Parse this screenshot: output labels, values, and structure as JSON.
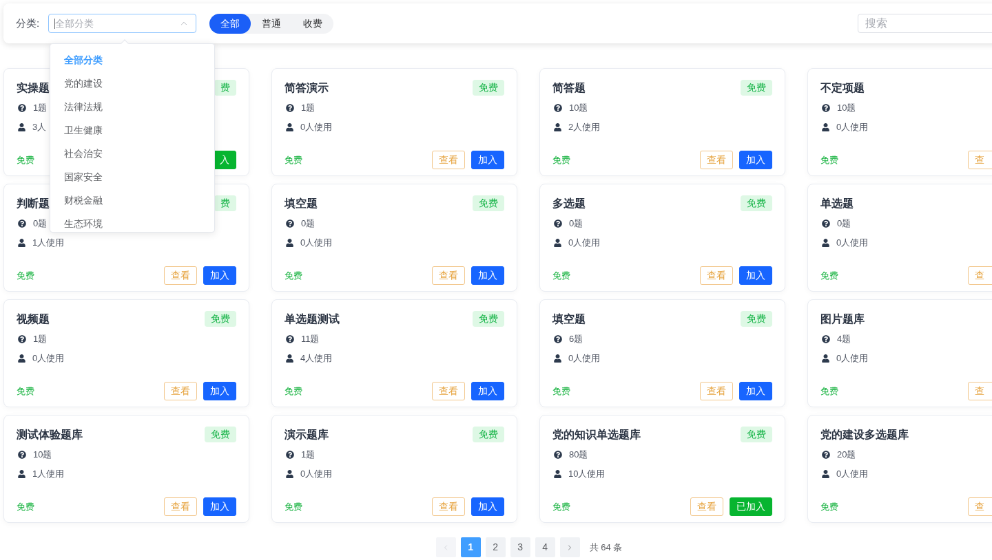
{
  "filter_bar": {
    "category_label": "分类:",
    "category_select": {
      "placeholder": "全部分类",
      "focused": true,
      "expanded": true,
      "options": [
        {
          "label": "全部分类",
          "selected": true
        },
        {
          "label": "党的建设",
          "selected": false
        },
        {
          "label": "法律法规",
          "selected": false
        },
        {
          "label": "卫生健康",
          "selected": false
        },
        {
          "label": "社会治安",
          "selected": false
        },
        {
          "label": "国家安全",
          "selected": false
        },
        {
          "label": "财税金融",
          "selected": false
        },
        {
          "label": "生态环境",
          "selected": false
        }
      ]
    },
    "type_tabs": [
      {
        "label": "全部",
        "selected": true
      },
      {
        "label": "普通",
        "selected": false
      },
      {
        "label": "收费",
        "selected": false
      }
    ],
    "search": {
      "placeholder": "搜索"
    }
  },
  "cards": [
    {
      "title": "实操题",
      "tag": "费",
      "questions": "1题",
      "users": "3人",
      "price": "免费",
      "buttons": [
        {
          "kind": "joined",
          "label": "入"
        }
      ]
    },
    {
      "title": "简答演示",
      "tag": "免费",
      "questions": "1题",
      "users": "0人使用",
      "price": "免费",
      "buttons": [
        {
          "kind": "view",
          "label": "查看"
        },
        {
          "kind": "join",
          "label": "加入"
        }
      ]
    },
    {
      "title": "简答题",
      "tag": "免费",
      "questions": "10题",
      "users": "2人使用",
      "price": "免费",
      "buttons": [
        {
          "kind": "view",
          "label": "查看"
        },
        {
          "kind": "join",
          "label": "加入"
        }
      ]
    },
    {
      "title": "不定项题",
      "questions": "10题",
      "users": "0人使用",
      "price": "免费",
      "buttons": [
        {
          "kind": "view",
          "label": "查"
        }
      ]
    },
    {
      "title": "判断题",
      "tag": "费",
      "questions": "0题",
      "users": "1人使用",
      "price": "免费",
      "buttons": [
        {
          "kind": "view",
          "label": "查看"
        },
        {
          "kind": "join",
          "label": "加入"
        }
      ]
    },
    {
      "title": "填空题",
      "tag": "免费",
      "questions": "0题",
      "users": "0人使用",
      "price": "免费",
      "buttons": [
        {
          "kind": "view",
          "label": "查看"
        },
        {
          "kind": "join",
          "label": "加入"
        }
      ]
    },
    {
      "title": "多选题",
      "tag": "免费",
      "questions": "0题",
      "users": "0人使用",
      "price": "免费",
      "buttons": [
        {
          "kind": "view",
          "label": "查看"
        },
        {
          "kind": "join",
          "label": "加入"
        }
      ]
    },
    {
      "title": "单选题",
      "questions": "0题",
      "users": "0人使用",
      "price": "免费",
      "buttons": [
        {
          "kind": "view",
          "label": "查"
        }
      ]
    },
    {
      "title": "视频题",
      "tag": "免费",
      "questions": "1题",
      "users": "0人使用",
      "price": "免费",
      "buttons": [
        {
          "kind": "view",
          "label": "查看"
        },
        {
          "kind": "join",
          "label": "加入"
        }
      ]
    },
    {
      "title": "单选题测试",
      "tag": "免费",
      "questions": "11题",
      "users": "4人使用",
      "price": "免费",
      "buttons": [
        {
          "kind": "view",
          "label": "查看"
        },
        {
          "kind": "join",
          "label": "加入"
        }
      ]
    },
    {
      "title": "填空题",
      "tag": "免费",
      "questions": "6题",
      "users": "0人使用",
      "price": "免费",
      "buttons": [
        {
          "kind": "view",
          "label": "查看"
        },
        {
          "kind": "join",
          "label": "加入"
        }
      ]
    },
    {
      "title": "图片题库",
      "questions": "4题",
      "users": "0人使用",
      "price": "免费",
      "buttons": [
        {
          "kind": "view",
          "label": "查"
        }
      ]
    },
    {
      "title": "测试体验题库",
      "tag": "免费",
      "questions": "10题",
      "users": "1人使用",
      "price": "免费",
      "buttons": [
        {
          "kind": "view",
          "label": "查看"
        },
        {
          "kind": "join",
          "label": "加入"
        }
      ]
    },
    {
      "title": "演示题库",
      "tag": "免费",
      "questions": "1题",
      "users": "0人使用",
      "price": "免费",
      "buttons": [
        {
          "kind": "view",
          "label": "查看"
        },
        {
          "kind": "join",
          "label": "加入"
        }
      ]
    },
    {
      "title": "党的知识单选题库",
      "tag": "免费",
      "questions": "80题",
      "users": "10人使用",
      "price": "免费",
      "buttons": [
        {
          "kind": "view",
          "label": "查看"
        },
        {
          "kind": "joined",
          "label": "已加入"
        }
      ]
    },
    {
      "title": "党的建设多选题库",
      "questions": "20题",
      "users": "0人使用",
      "price": "免费",
      "buttons": [
        {
          "kind": "view",
          "label": "查"
        }
      ]
    }
  ],
  "pagination": {
    "prev": {
      "disabled": true
    },
    "pages": [
      {
        "label": "1",
        "selected": true
      },
      {
        "label": "2",
        "selected": false
      },
      {
        "label": "3",
        "selected": false
      },
      {
        "label": "4",
        "selected": false
      }
    ],
    "next": {
      "disabled": false
    },
    "total": "共 64 条"
  }
}
